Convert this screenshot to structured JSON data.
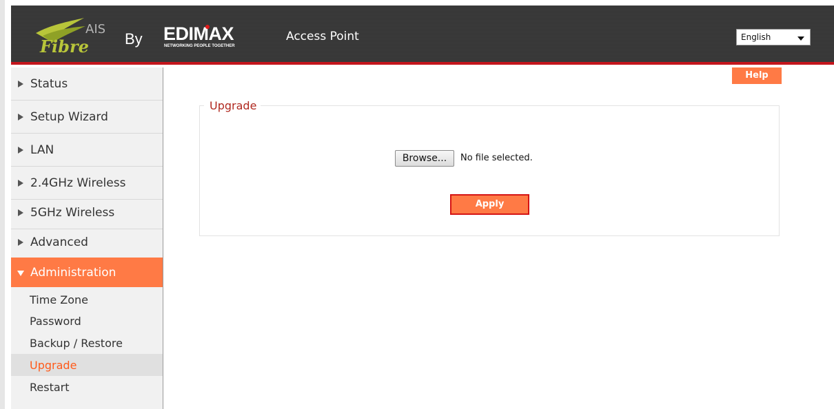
{
  "header": {
    "logo_text_top": "AIS",
    "logo_text_bottom": "Fibre",
    "by_label": "By",
    "brand": "EDIMAX",
    "brand_tagline": "NETWORKING PEOPLE TOGETHER",
    "app_title": "Access Point",
    "language": "English"
  },
  "sidebar": {
    "items": [
      {
        "label": "Status"
      },
      {
        "label": "Setup Wizard"
      },
      {
        "label": "LAN"
      },
      {
        "label": "2.4GHz Wireless"
      },
      {
        "label": "5GHz Wireless"
      },
      {
        "label": "Advanced"
      },
      {
        "label": "Administration",
        "active": true
      }
    ],
    "subitems": [
      {
        "label": "Time Zone"
      },
      {
        "label": "Password"
      },
      {
        "label": "Backup / Restore"
      },
      {
        "label": "Upgrade",
        "active": true
      },
      {
        "label": "Restart"
      }
    ]
  },
  "main": {
    "help_label": "Help",
    "section_title": "Upgrade",
    "browse_label": "Browse...",
    "file_status": "No file selected.",
    "apply_label": "Apply"
  },
  "colors": {
    "accent": "#ff7a45",
    "header_bg": "#3a3a3a",
    "header_border": "#c4161c",
    "legend": "#b0281f",
    "active_sub_text": "#ff5a1a"
  }
}
